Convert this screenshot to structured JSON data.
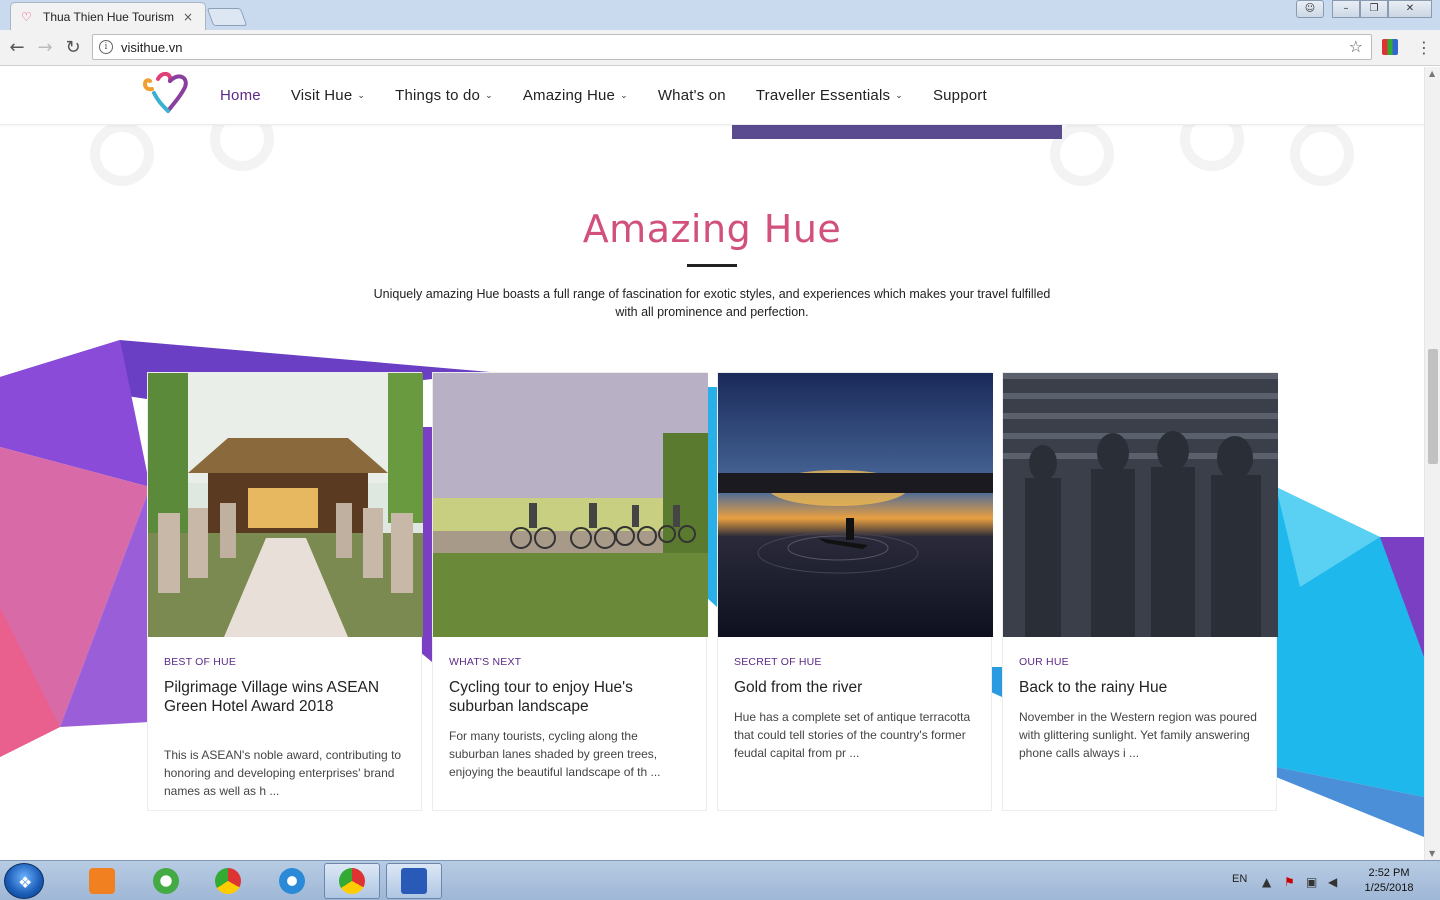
{
  "browser": {
    "tab_title": "Thua Thien Hue Tourism Po",
    "tab_close": "×",
    "url": "visithue.vn"
  },
  "site": {
    "nav": [
      {
        "label": "Home",
        "active": true,
        "dropdown": false
      },
      {
        "label": "Visit Hue",
        "active": false,
        "dropdown": true
      },
      {
        "label": "Things to do",
        "active": false,
        "dropdown": true
      },
      {
        "label": "Amazing Hue",
        "active": false,
        "dropdown": true
      },
      {
        "label": "What's on",
        "active": false,
        "dropdown": false
      },
      {
        "label": "Traveller Essentials",
        "active": false,
        "dropdown": true
      },
      {
        "label": "Support",
        "active": false,
        "dropdown": false
      }
    ]
  },
  "section": {
    "title": "Amazing Hue",
    "description": "Uniquely amazing Hue boasts a full range of fascination for exotic styles, and experiences which makes your travel fulfilled with all prominence and perfection."
  },
  "cards": [
    {
      "category": "BEST OF HUE",
      "title": "Pilgrimage Village wins ASEAN Green Hotel Award 2018",
      "excerpt": "This is ASEAN's noble award, contributing to honoring and developing enterprises' brand names as well as h ..."
    },
    {
      "category": "WHAT'S NEXT",
      "title": "Cycling tour to enjoy Hue's suburban landscape",
      "excerpt": "For many tourists, cycling along the suburban lanes shaded by green trees, enjoying the beautiful landscape of th ..."
    },
    {
      "category": "SECRET OF HUE",
      "title": "Gold from the river",
      "excerpt": "Hue has a complete set of antique terracotta that could tell stories of the country's former feudal capital from pr ..."
    },
    {
      "category": "OUR HUE",
      "title": "Back to the rainy Hue",
      "excerpt": "November in the Western region was poured with glittering sunlight. Yet family answering phone calls always i ..."
    }
  ],
  "taskbar": {
    "language": "EN",
    "time": "2:52 PM",
    "date": "1/25/2018"
  },
  "colors": {
    "accent_purple": "#5b2a86",
    "title_pink": "#d1507c"
  }
}
